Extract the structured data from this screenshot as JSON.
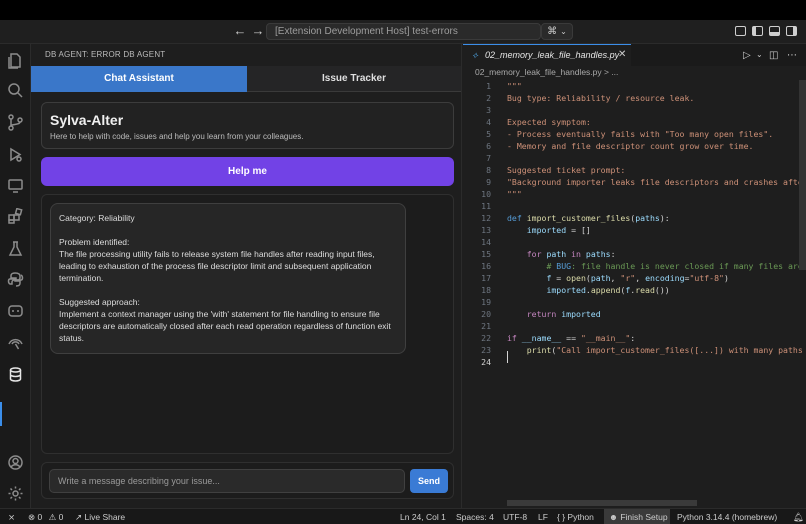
{
  "titlebar": {
    "command_center": "[Extension Development Host] test-errors",
    "copilot_label": "✓"
  },
  "panel": {
    "header": "DB AGENT: ERROR DB AGENT",
    "tabs": [
      {
        "label": "Chat Assistant"
      },
      {
        "label": "Issue Tracker"
      }
    ],
    "agent": {
      "name": "Sylva-Alter",
      "subtitle": "Here to help with code, issues and help you learn from your colleagues."
    },
    "help_button": "Help me",
    "message": {
      "category": "Category: Reliability",
      "problem_heading": "Problem identified:",
      "problem_text": "The file processing utility fails to release system file handles after reading input files, leading to exhaustion of the process file descriptor limit and subsequent application termination.",
      "approach_heading": "Suggested approach:",
      "approach_text": "Implement a context manager using the 'with' statement for file handling to ensure file descriptors are automatically closed after each read operation regardless of function exit status."
    },
    "input_placeholder": "Write a message describing your issue...",
    "send_button": "Send"
  },
  "editor": {
    "tab_label": "02_memory_leak_file_handles.py",
    "breadcrumb": "02_memory_leak_file_handles.py > ..."
  },
  "statusbar": {
    "errors": "0",
    "warnings": "0",
    "live_share": "Live Share",
    "position": "Ln 24, Col 1",
    "spaces": "Spaces: 4",
    "encoding": "UTF-8",
    "eol": "LF",
    "language": "Python",
    "finish_setup": "Finish Setup",
    "interpreter": "Python 3.14.4 (homebrew)"
  }
}
